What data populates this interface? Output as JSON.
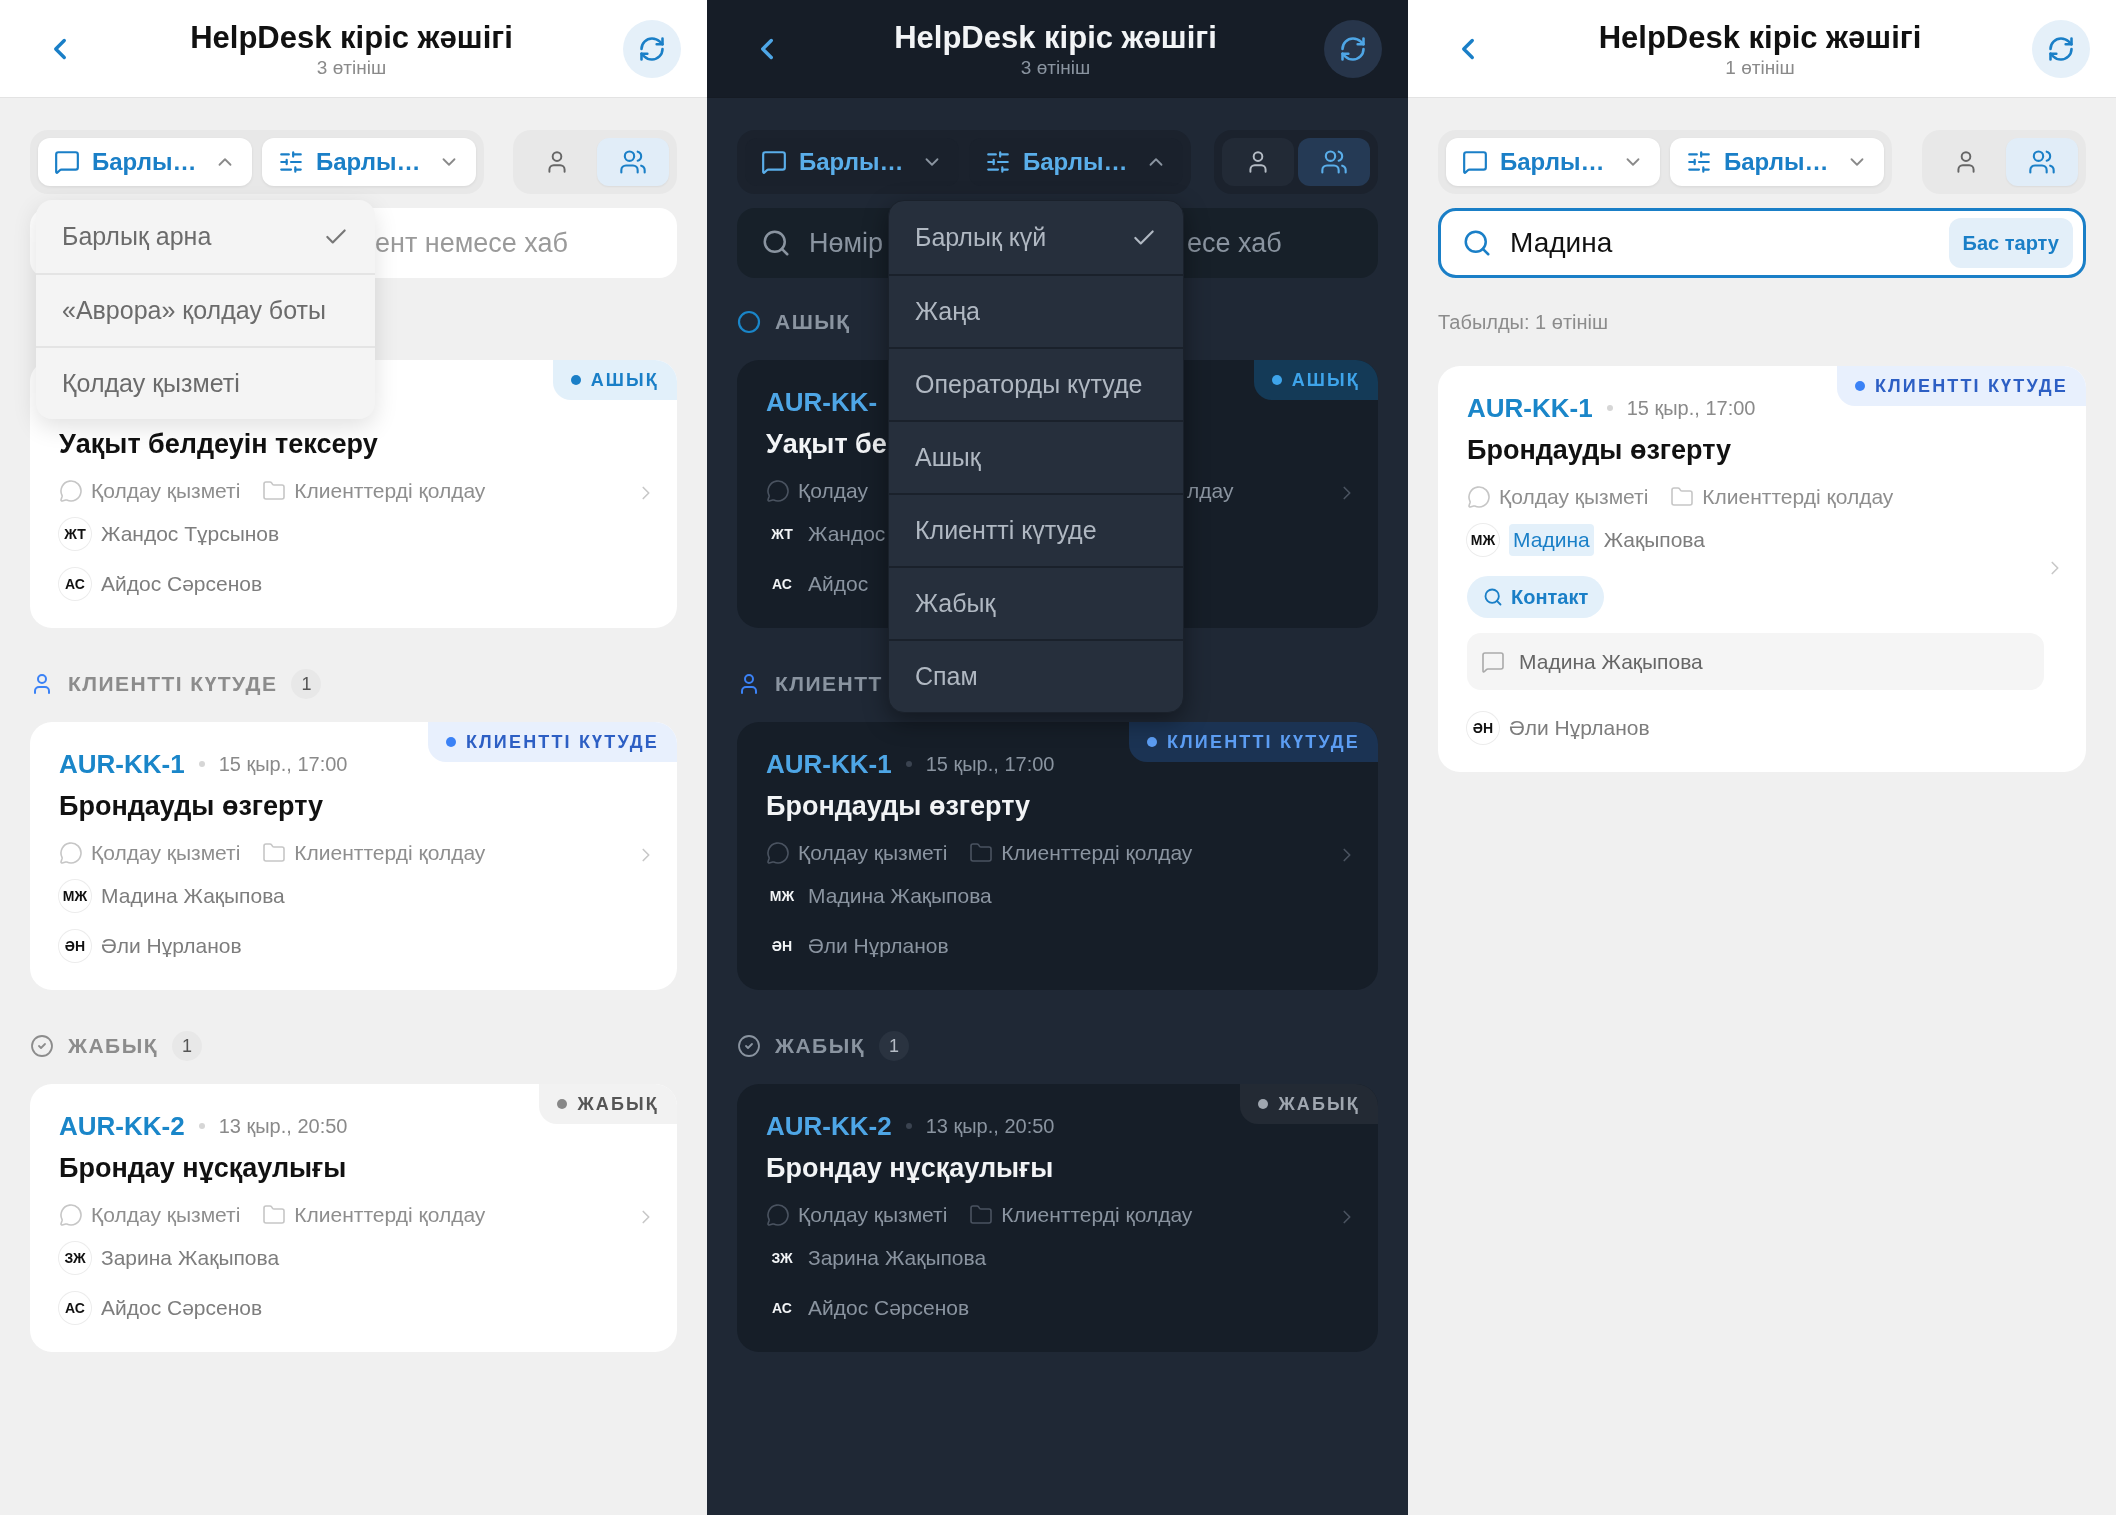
{
  "panels": [
    {
      "kind": "light",
      "header": {
        "title": "HelpDesk кіріс жәшігі",
        "subtitle": "3 өтініш"
      },
      "filters": [
        {
          "kind": "channel",
          "label": "Барлы…",
          "expanded": true,
          "menu": [
            {
              "text": "Барлық арна",
              "selected": true
            },
            {
              "text": "«Аврора» қолдау боты",
              "selected": false
            },
            {
              "text": "Қолдау қызметі",
              "selected": false
            }
          ]
        },
        {
          "kind": "status",
          "label": "Барлы…",
          "expanded": false
        }
      ],
      "view_toggle": [
        {
          "kind": "single",
          "selected": false
        },
        {
          "kind": "group",
          "selected": true
        }
      ],
      "search": {
        "placeholder_parts": [
          {
            "kind": "tail",
            "text": "ент немесе хаб"
          }
        ]
      },
      "sections": [
        {
          "cards": [
            {
              "kind": "open",
              "badge": "АШЫҚ",
              "title": "Уақыт белдеуін тексеру",
              "meta": [
                {
                  "kind": "channel",
                  "text": "Қолдау қызметі"
                },
                {
                  "kind": "group",
                  "text": "Клиенттерді қолдау"
                }
              ],
              "rows": [
                {
                  "kind": "person",
                  "initials": "ЖТ",
                  "name": "Жандос Тұрсынов"
                },
                {
                  "kind": "person",
                  "initials": "АС",
                  "name": "Айдос Сәрсенов"
                }
              ]
            }
          ]
        },
        {
          "kind": "waiting",
          "label": "КЛИЕНТТІ КҮТУДЕ",
          "count": "1",
          "cards": [
            {
              "kind": "waiting",
              "badge": "КЛИЕНТТІ КҮТУДЕ",
              "id": "AUR-KK-1",
              "date": "15 қыр., 17:00",
              "title": "Брондауды өзгерту",
              "meta": [
                {
                  "kind": "channel",
                  "text": "Қолдау қызметі"
                },
                {
                  "kind": "group",
                  "text": "Клиенттерді қолдау"
                }
              ],
              "rows": [
                {
                  "kind": "person",
                  "initials": "МЖ",
                  "name": "Мадина Жақыпова"
                },
                {
                  "kind": "person",
                  "initials": "ӘН",
                  "name": "Әли Нұрланов"
                }
              ]
            }
          ]
        },
        {
          "kind": "closed",
          "label": "ЖАБЫҚ",
          "count": "1",
          "cards": [
            {
              "kind": "closed",
              "badge": "ЖАБЫҚ",
              "id": "AUR-KK-2",
              "date": "13 қыр., 20:50",
              "title": "Брондау нұсқаулығы",
              "meta": [
                {
                  "kind": "channel",
                  "text": "Қолдау қызметі"
                },
                {
                  "kind": "group",
                  "text": "Клиенттерді қолдау"
                }
              ],
              "rows": [
                {
                  "kind": "person",
                  "initials": "ЗЖ",
                  "name": "Зарина Жақыпова"
                },
                {
                  "kind": "person",
                  "initials": "АС",
                  "name": "Айдос Сәрсенов"
                }
              ]
            }
          ]
        }
      ]
    },
    {
      "kind": "dark",
      "header": {
        "title": "HelpDesk кіріс жәшігі",
        "subtitle": "3 өтініш"
      },
      "filters": [
        {
          "kind": "channel",
          "label": "Барлы…",
          "expanded": false
        },
        {
          "kind": "status",
          "label": "Барлы…",
          "expanded": true,
          "menu": [
            {
              "text": "Барлық күй",
              "selected": true
            },
            {
              "text": "Жаңа",
              "selected": false
            },
            {
              "text": "Операторды күтуде",
              "selected": false
            },
            {
              "text": "Ашық",
              "selected": false
            },
            {
              "text": "Клиентті күтуде",
              "selected": false
            },
            {
              "text": "Жабық",
              "selected": false
            },
            {
              "text": "Спам",
              "selected": false
            }
          ]
        }
      ],
      "view_toggle": [
        {
          "kind": "single",
          "selected": false
        },
        {
          "kind": "group",
          "selected": true
        }
      ],
      "search": {
        "placeholder_parts": [
          {
            "kind": "head",
            "text": "Нөмір"
          },
          {
            "kind": "tail",
            "text": "есе хаб"
          }
        ]
      },
      "sections": [
        {
          "kind": "open",
          "label": "АШЫҚ",
          "cards": [
            {
              "kind": "open",
              "badge": "АШЫҚ",
              "id": "AUR-KK-",
              "title": "Уақыт бе",
              "meta": [
                {
                  "kind": "channel",
                  "text": "Қолдау"
                },
                {
                  "kind": "group_tail",
                  "text": "лдау"
                }
              ],
              "rows": [
                {
                  "kind": "person",
                  "initials": "ЖТ",
                  "name": "Жандос"
                },
                {
                  "kind": "person",
                  "initials": "АС",
                  "name": "Айдос"
                }
              ]
            }
          ]
        },
        {
          "kind": "waiting",
          "label": "КЛИЕНТТ",
          "cards": [
            {
              "kind": "waiting",
              "badge": "КЛИЕНТТІ КҮТУДЕ",
              "id": "AUR-KK-1",
              "date": "15 қыр., 17:00",
              "title": "Брондауды өзгерту",
              "meta": [
                {
                  "kind": "channel",
                  "text": "Қолдау қызметі"
                },
                {
                  "kind": "group",
                  "text": "Клиенттерді қолдау"
                }
              ],
              "rows": [
                {
                  "kind": "person",
                  "initials": "МЖ",
                  "name": "Мадина Жақыпова"
                },
                {
                  "kind": "person",
                  "initials": "ӘН",
                  "name": "Әли Нұрланов"
                }
              ]
            }
          ]
        },
        {
          "kind": "closed",
          "label": "ЖАБЫҚ",
          "count": "1",
          "cards": [
            {
              "kind": "closed",
              "badge": "ЖАБЫҚ",
              "id": "AUR-KK-2",
              "date": "13 қыр., 20:50",
              "title": "Брондау нұсқаулығы",
              "meta": [
                {
                  "kind": "channel",
                  "text": "Қолдау қызметі"
                },
                {
                  "kind": "group",
                  "text": "Клиенттерді қолдау"
                }
              ],
              "rows": [
                {
                  "kind": "person",
                  "initials": "ЗЖ",
                  "name": "Зарина Жақыпова"
                },
                {
                  "kind": "person",
                  "initials": "АС",
                  "name": "Айдос Сәрсенов"
                }
              ]
            }
          ]
        }
      ]
    },
    {
      "kind": "light",
      "header": {
        "title": "HelpDesk кіріс жәшігі",
        "subtitle": "1 өтініш"
      },
      "filters": [
        {
          "kind": "channel",
          "label": "Барлы…",
          "expanded": false
        },
        {
          "kind": "status",
          "label": "Барлы…",
          "expanded": false
        }
      ],
      "view_toggle": [
        {
          "kind": "single",
          "selected": false
        },
        {
          "kind": "group",
          "selected": true
        }
      ],
      "search": {
        "value": "Мадина",
        "action": "Бас тарту"
      },
      "results": {
        "label": "Табылды: 1 өтініш",
        "cards": [
          {
            "kind": "waiting",
            "badge": "КЛИЕНТТІ КҮТУДЕ",
            "id": "AUR-KK-1",
            "date": "15 қыр., 17:00",
            "title": "Брондауды өзгерту",
            "meta": [
              {
                "kind": "channel",
                "text": "Қолдау қызметі"
              },
              {
                "kind": "group",
                "text": "Клиенттерді қолдау"
              }
            ],
            "rows": [
              {
                "kind": "person",
                "initials": "МЖ",
                "highlight": "Мадина",
                "name": "Жақыпова"
              },
              {
                "kind": "chip",
                "text": "Контакт"
              },
              {
                "kind": "match",
                "text": "Мадина Жақыпова"
              },
              {
                "kind": "person",
                "initials": "ӘН",
                "name": "Әли Нұрланов"
              }
            ]
          }
        ]
      }
    }
  ]
}
